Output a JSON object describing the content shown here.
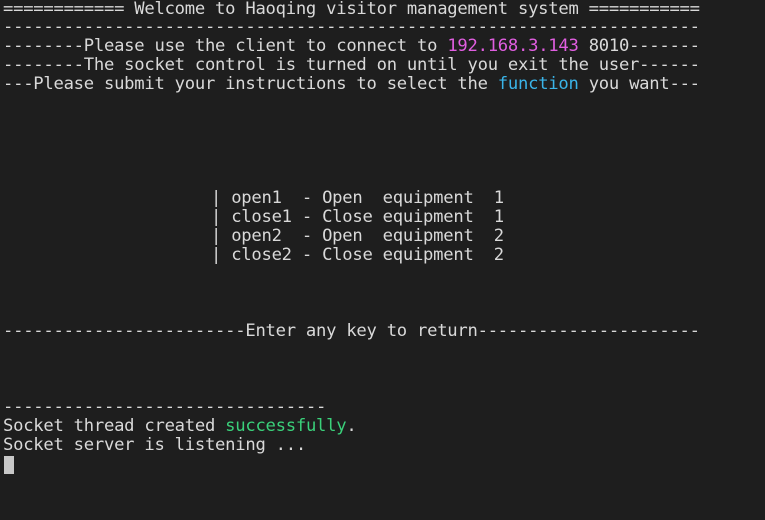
{
  "terminal": {
    "line1": "============ Welcome to Haoqing visitor management system ===========",
    "line2": "---------------------------------------------------------------------",
    "line3_pre": "--------Please use the client to connect to ",
    "line3_ip": "192.168.3.143",
    "line3_post": " 8010-------",
    "line4": "--------The socket control is turned on until you exit the user------",
    "line5_pre": "---Please submit your instructions to select the ",
    "line5_func": "function",
    "line5_post": " you want---",
    "menu": [
      "| open1  - Open  equipment  1",
      "| close1 - Close equipment  1",
      "| open2  - Open  equipment  2",
      "| close2 - Close equipment  2"
    ],
    "return_line": "------------------------Enter any key to return----------------------",
    "divider": "--------------------------------",
    "status1_pre": "Socket thread created ",
    "status1_word": "successfully",
    "status1_post": ".",
    "status2": "Socket server is listening ..."
  },
  "colors": {
    "background": "#1e1e1e",
    "text": "#d9d9d9",
    "ip": "#e05ee0",
    "function_word": "#3ab4e8",
    "success_word": "#3ad07a"
  }
}
